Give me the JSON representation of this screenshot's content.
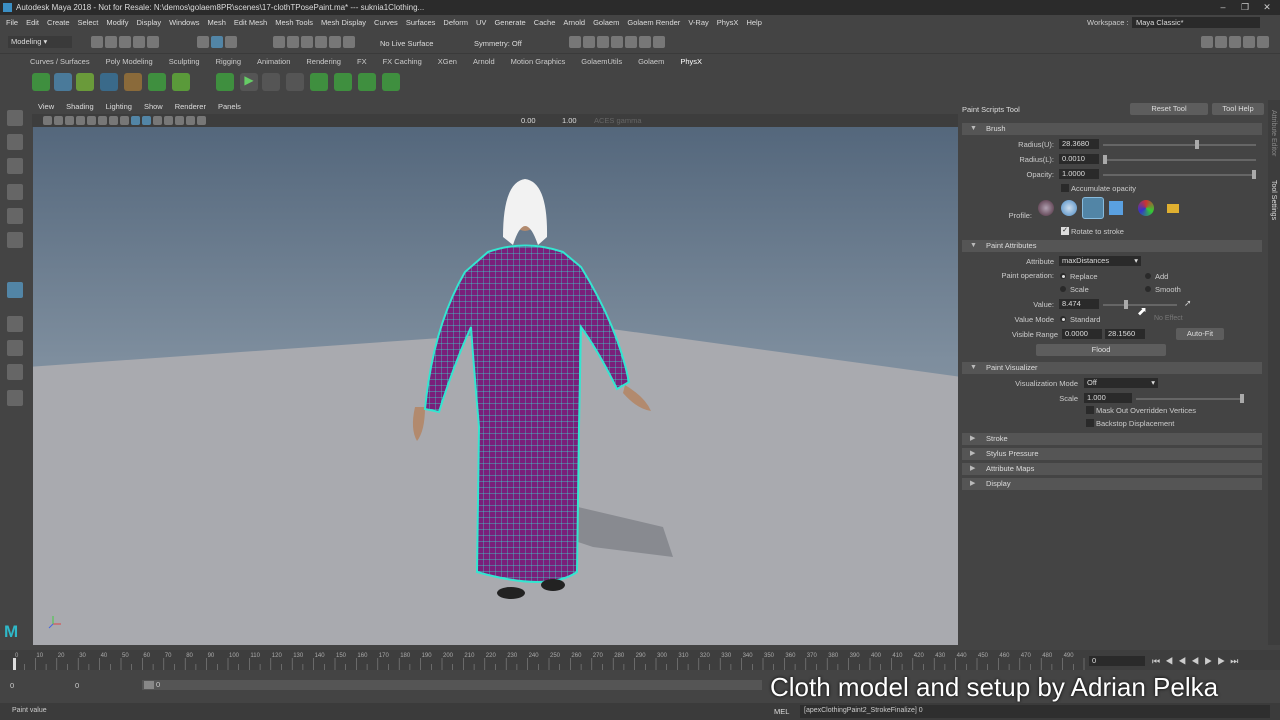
{
  "titlebar": {
    "title": "Autodesk Maya 2018 - Not for Resale: N:\\demos\\golaem8PR\\scenes\\17-clothTPosePaint.ma*  ---  suknia1Clothing..."
  },
  "menubar": [
    "File",
    "Edit",
    "Create",
    "Select",
    "Modify",
    "Display",
    "Windows",
    "Mesh",
    "Edit Mesh",
    "Mesh Tools",
    "Mesh Display",
    "Curves",
    "Surfaces",
    "Deform",
    "UV",
    "Generate",
    "Cache",
    "Arnold",
    "Golaem",
    "Golaem Render",
    "V-Ray",
    "PhysX",
    "Help"
  ],
  "workspace": {
    "label": "Workspace :",
    "value": "Maya Classic*"
  },
  "statusline": {
    "mode": "Modeling",
    "live": "No Live Surface",
    "symmetry": "Symmetry: Off"
  },
  "shelf_tabs": [
    "Curves / Surfaces",
    "Poly Modeling",
    "Sculpting",
    "Rigging",
    "Animation",
    "Rendering",
    "FX",
    "FX Caching",
    "XGen",
    "Arnold",
    "Motion Graphics",
    "GolaemUtils",
    "Golaem",
    "PhysX"
  ],
  "shelf_active": "PhysX",
  "panel_menu": [
    "View",
    "Shading",
    "Lighting",
    "Show",
    "Renderer",
    "Panels"
  ],
  "panel_toolbar": {
    "v1": "0.00",
    "v2": "1.00",
    "gamma": "ACES gamma"
  },
  "tool": {
    "title": "Paint Scripts Tool",
    "reset": "Reset Tool",
    "help": "Tool Help"
  },
  "brush": {
    "header": "Brush",
    "radius_u_label": "Radius(U):",
    "radius_u": "28.3680",
    "radius_u_frac": 0.62,
    "radius_l_label": "Radius(L):",
    "radius_l": "0.0010",
    "radius_l_frac": 0.0,
    "opacity_label": "Opacity:",
    "opacity": "1.0000",
    "opacity_frac": 1.0,
    "accumulate": "Accumulate opacity",
    "profile_label": "Profile:",
    "rotate": "Rotate to stroke"
  },
  "paint_attributes": {
    "header": "Paint Attributes",
    "attribute_label": "Attribute",
    "attribute": "maxDistances",
    "operation_label": "Paint operation:",
    "ops": [
      "Replace",
      "Add",
      "Scale",
      "Smooth"
    ],
    "value_label": "Value:",
    "value": "8.474",
    "value_frac": 0.3,
    "value_mode_label": "Value Mode",
    "value_mode": "Standard",
    "no_effect": "No Effect",
    "visible_range_label": "Visible Range",
    "range_min": "0.0000",
    "range_max": "28.1560",
    "autofit": "Auto-Fit",
    "flood": "Flood"
  },
  "paint_visualizer": {
    "header": "Paint Visualizer",
    "mode_label": "Visualization Mode",
    "mode": "Off",
    "scale_label": "Scale",
    "scale": "1.000",
    "mask": "Mask Out Overridden Vertices",
    "backstop": "Backstop Displacement"
  },
  "collapsed_sections": [
    "Stroke",
    "Stylus Pressure",
    "Attribute Maps",
    "Display"
  ],
  "side_tabs": [
    "Attribute Editor",
    "Tool Settings"
  ],
  "timeline": {
    "ticks": [
      "0",
      "5",
      "10",
      "15",
      "20",
      "25",
      "30",
      "35",
      "40",
      "45",
      "50",
      "55",
      "60",
      "65",
      "70",
      "75",
      "80",
      "85",
      "90",
      "95",
      "100",
      "105",
      "110",
      "115",
      "120",
      "125",
      "130",
      "135",
      "140",
      "145",
      "150",
      "155",
      "160",
      "165",
      "170",
      "175",
      "180",
      "185",
      "190",
      "195",
      "200",
      "205",
      "210",
      "215",
      "220",
      "225",
      "230",
      "235",
      "240",
      "245",
      "250",
      "255",
      "260",
      "265",
      "270",
      "275",
      "280",
      "285",
      "290",
      "295",
      "300",
      "305",
      "310",
      "315",
      "320",
      "325",
      "330",
      "335",
      "340",
      "345",
      "350",
      "355",
      "360",
      "365",
      "370",
      "375",
      "380",
      "385",
      "390",
      "395",
      "400",
      "405",
      "410",
      "415",
      "420",
      "425",
      "430",
      "435",
      "440",
      "445",
      "450",
      "455",
      "460",
      "465",
      "470",
      "475",
      "480",
      "485",
      "490",
      "495",
      "500"
    ],
    "current": "0"
  },
  "range": {
    "start": "0",
    "inner_start": "0",
    "value": "0"
  },
  "cmdline": {
    "hint": "Paint value",
    "lang": "MEL",
    "output": "[apexClothingPaint2_StrokeFinalize] 0"
  },
  "caption": "Cloth model and setup by Adrian Pelka",
  "colors": {
    "wire": "#33e6d0",
    "cloth": "#7a1f7a",
    "accent": "#5285a6"
  }
}
